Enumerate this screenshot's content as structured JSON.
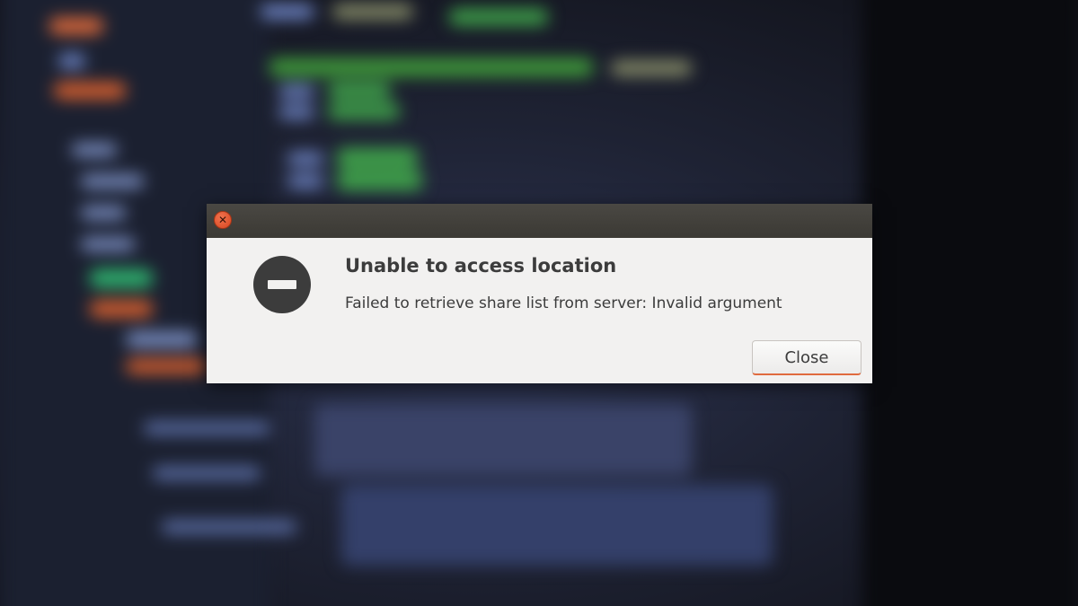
{
  "dialog": {
    "icon": "error-icon",
    "close_icon": "close-icon",
    "title": "Unable to access location",
    "message": "Failed to retrieve share list from server: Invalid argument",
    "close_button_label": "Close"
  },
  "colors": {
    "titlebar": "#3b3934",
    "dialog_background": "#f2f1f0",
    "text": "#3c3c3c",
    "close_window_button": "#e5582f",
    "button_focus_underline": "#e06b3f"
  }
}
